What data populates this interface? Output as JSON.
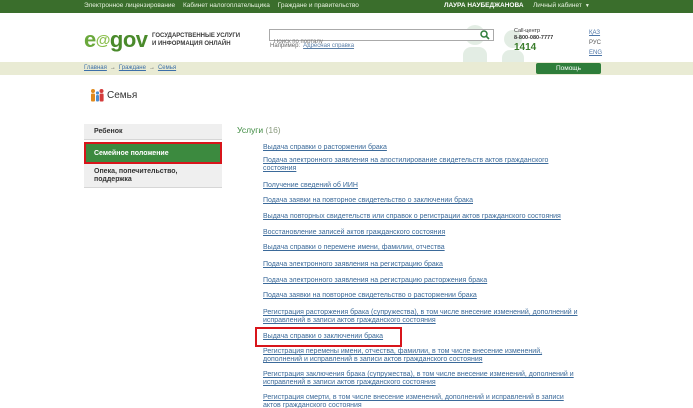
{
  "topbar": {
    "links": [
      "Электронное лицензирование",
      "Кабинет налогоплательщика",
      "Граждане и правительство"
    ],
    "user": "ЛАУРА НАУБЕДЖАНОВА",
    "cabinet": "Личный кабинет"
  },
  "header": {
    "logo": {
      "e": "e",
      "gov": "gov"
    },
    "tagline": [
      "ГОСУДАРСТВЕННЫЕ УСЛУГИ",
      "И ИНФОРМАЦИЯ ОНЛАЙН"
    ],
    "search": {
      "placeholder": "Поиск по порталу"
    },
    "hint": {
      "label": "Например:",
      "link": "Адресная справка"
    },
    "callcenter": {
      "label": "Call-центр",
      "phone": "8-800-080-7777",
      "short": "1414"
    },
    "languages": [
      "ҚАЗ",
      "РУС",
      "ENG"
    ],
    "active_language": "РУС"
  },
  "breadcrumb": {
    "home": "Главная",
    "citizens": "Граждане",
    "current": "Семья",
    "sep": "→"
  },
  "help_button": "Помощь",
  "page_title": "Семья",
  "sidenav": [
    "Ребенок",
    "Семейное положение",
    "Опека, попечительство, поддержка"
  ],
  "services": {
    "title": "Услуги",
    "count": "(16)",
    "items": [
      [
        "Выдача справки о расторжении брака"
      ],
      [
        "Подача электронного заявления на апостилирование свидетельств актов гражданского",
        "состояния"
      ],
      [
        "Получение сведений об ИИН"
      ],
      [
        "Подача заявки на повторное свидетельство о заключении брака"
      ],
      [
        "Выдача повторных свидетельств или справок о регистрации актов гражданского состояния"
      ],
      [
        "Восстановление записей актов гражданского состояния"
      ],
      [
        "Выдача справки о перемене имени, фамилии, отчества"
      ],
      [
        "Подача электронного заявления на регистрацию брака"
      ],
      [
        "Подача электронного заявления на регистрацию расторжения брака"
      ],
      [
        "Подача заявки на повторное свидетельство о расторжении брака"
      ],
      [
        "Регистрация расторжения брака (супружества), в том числе внесение изменений, дополнений и",
        "исправлений в записи актов гражданского состояния"
      ],
      [
        "Выдача справки о заключении брака"
      ],
      [
        "Регистрация перемены имени, отчества, фамилии, в том числе внесение изменений,",
        "дополнений и исправлений в записи актов гражданского состояния"
      ],
      [
        "Регистрация заключения брака (супружества), в том числе внесение изменений, дополнений и",
        "исправлений в записи актов гражданского состояния"
      ],
      [
        "Регистрация смерти, в том числе внесение изменений, дополнений и исправлений в записи",
        "актов гражданского состояния"
      ]
    ]
  },
  "colors": {
    "brand_green": "#3c8a3f",
    "topbar": "#3a6e2c",
    "highlight": "#d8151b",
    "link": "#3b6a9a"
  }
}
